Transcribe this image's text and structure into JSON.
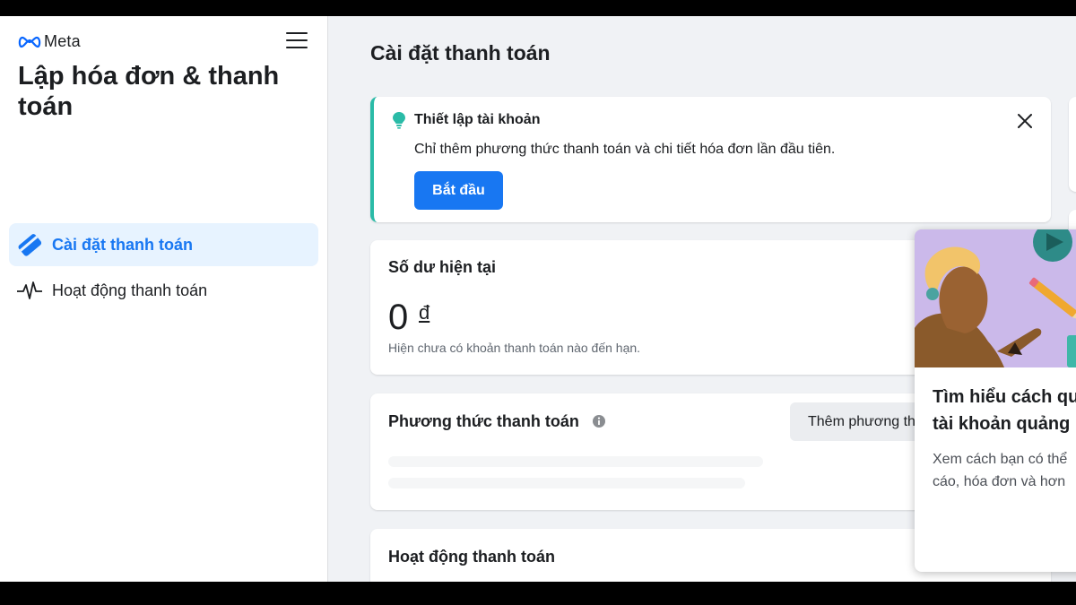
{
  "brand": {
    "logo_text": "Meta",
    "accent": "#1877f2"
  },
  "sidebar": {
    "title": "Lập hóa đơn & thanh toán",
    "menu_icon": "hamburger-menu-icon",
    "items": [
      {
        "label": "Cài đặt thanh toán",
        "icon": "credit-card-icon",
        "active": true
      },
      {
        "label": "Hoạt động thanh toán",
        "icon": "activity-pulse-icon",
        "active": false
      }
    ]
  },
  "main": {
    "page_title": "Cài đặt thanh toán",
    "setup_card": {
      "icon": "lightbulb-icon",
      "title": "Thiết lập tài khoản",
      "description": "Chỉ thêm phương thức thanh toán và chi tiết hóa đơn lần đầu tiên.",
      "button_label": "Bắt đầu",
      "close_icon": "close-icon",
      "accent": "#2abba7"
    },
    "balance_card": {
      "title": "Số dư hiện tại",
      "amount": "0",
      "currency": "đ",
      "note": "Hiện chưa có khoản thanh toán nào đến hạn."
    },
    "payment_methods_card": {
      "title": "Phương thức thanh toán",
      "info_icon": "info-icon",
      "button_label": "Thêm phương thức thanh toán"
    },
    "activity_card": {
      "title": "Hoạt động thanh toán"
    }
  },
  "promo_popup": {
    "title": "Tìm hiểu cách quản lý tài khoản quảng cáo",
    "title_lines": [
      "Tìm hiểu cách qu",
      "tài khoản quảng"
    ],
    "description_lines": [
      "Xem cách bạn có thể",
      "cáo, hóa đơn và hơn"
    ]
  }
}
